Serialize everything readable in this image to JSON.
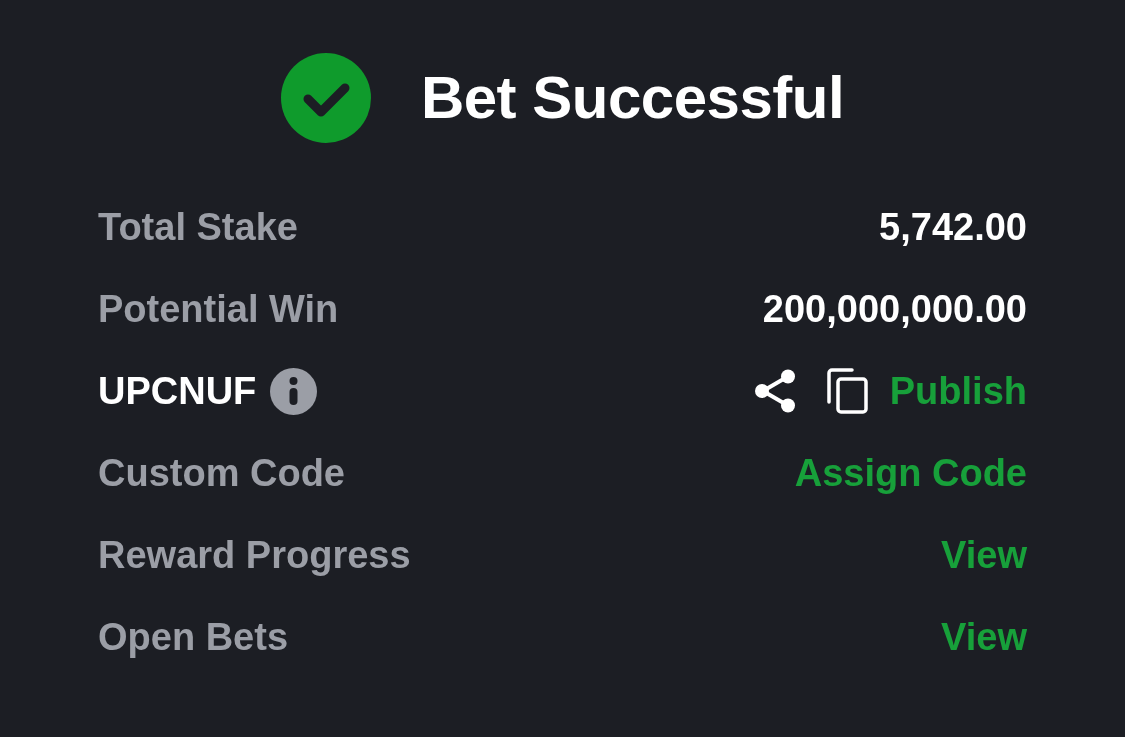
{
  "header": {
    "title": "Bet Successful"
  },
  "rows": [
    {
      "kind": "value",
      "label": "Total Stake",
      "value": "5,742.00"
    },
    {
      "kind": "value",
      "label": "Potential Win",
      "value": "200,000,000.00"
    },
    {
      "kind": "code",
      "label": "UPCNUF",
      "action": "Publish"
    },
    {
      "kind": "link",
      "label": "Custom Code",
      "action": "Assign Code"
    },
    {
      "kind": "link",
      "label": "Reward Progress",
      "action": "View"
    },
    {
      "kind": "link",
      "label": "Open Bets",
      "action": "View"
    }
  ]
}
